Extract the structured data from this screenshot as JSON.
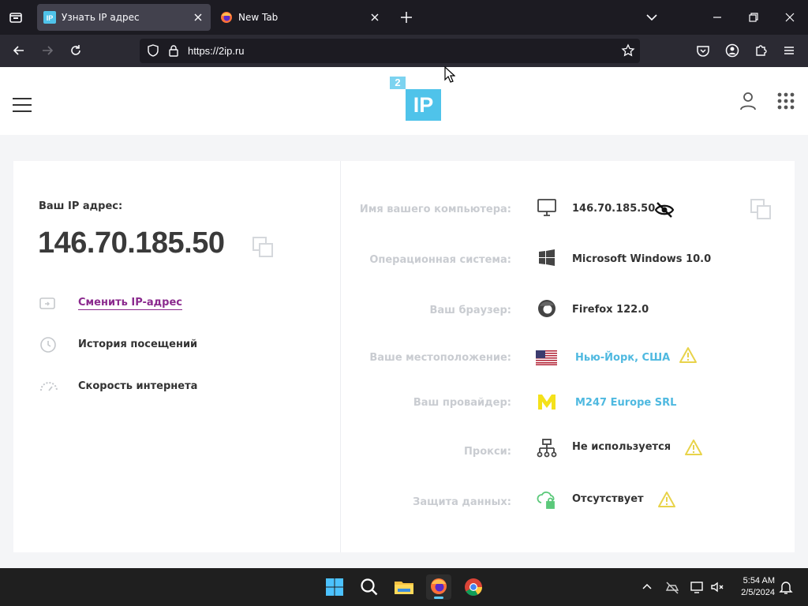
{
  "browser": {
    "tabs": [
      {
        "title": "Узнать IP адрес",
        "active": true
      },
      {
        "title": "New Tab",
        "active": false
      }
    ],
    "url": "https://2ip.ru"
  },
  "site": {
    "logo_small": "2",
    "logo_big": "IP"
  },
  "left": {
    "your_ip_label": "Ваш IP адрес:",
    "ip": "146.70.185.50",
    "links": [
      {
        "label": "Сменить IP-адрес",
        "icon": "swap-icon"
      },
      {
        "label": "История посещений",
        "icon": "history-icon"
      },
      {
        "label": "Скорость интернета",
        "icon": "speedometer-icon"
      }
    ]
  },
  "right": {
    "rows": [
      {
        "label": "Имя вашего компьютера:",
        "value": "146.70.185.50",
        "icon": "monitor-icon"
      },
      {
        "label": "Операционная система:",
        "value": "Microsoft Windows 10.0",
        "icon": "windows-icon"
      },
      {
        "label": "Ваш браузер:",
        "value": "Firefox 122.0",
        "icon": "firefox-icon"
      },
      {
        "label": "Ваше местоположение:",
        "value": "Нью-Йорк, США",
        "icon": "us-flag-icon"
      },
      {
        "label": "Ваш провайдер:",
        "value": "M247 Europe SRL",
        "icon": "provider-logo-icon"
      },
      {
        "label": "Прокси:",
        "value": "Не используется",
        "icon": "network-icon"
      },
      {
        "label": "Защита данных:",
        "value": "Отсутствует",
        "icon": "cloud-lock-icon"
      }
    ]
  },
  "taskbar": {
    "time": "5:54 AM",
    "date": "2/5/2024"
  },
  "colors": {
    "accent_blue": "#4fc3ea",
    "link_purple": "#8b2a8e",
    "warning": "#e8d34a"
  }
}
